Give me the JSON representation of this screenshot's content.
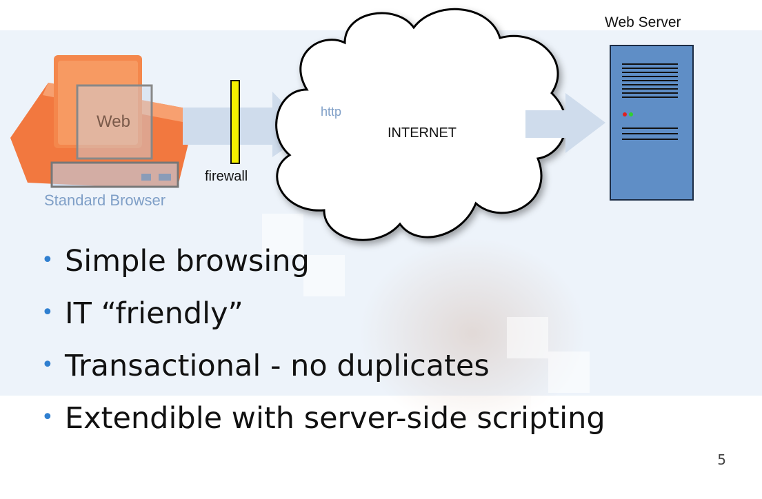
{
  "diagram": {
    "device_web_label": "Web",
    "device_caption": "Standard Browser",
    "firewall_label": "firewall",
    "protocol_label": "http",
    "cloud_label": "INTERNET",
    "server_label": "Web Server"
  },
  "bullets": [
    "Simple browsing",
    "IT “friendly”",
    "Transactional - no duplicates",
    "Extendible with server-side scripting"
  ],
  "page_number": "5",
  "colors": {
    "device_orange": "#f2783f",
    "firewall_yellow": "#f5f000",
    "server_blue": "#5f8ec6",
    "arrow_fill": "#cfdcec",
    "bullet_blue": "#2f7fd0"
  }
}
